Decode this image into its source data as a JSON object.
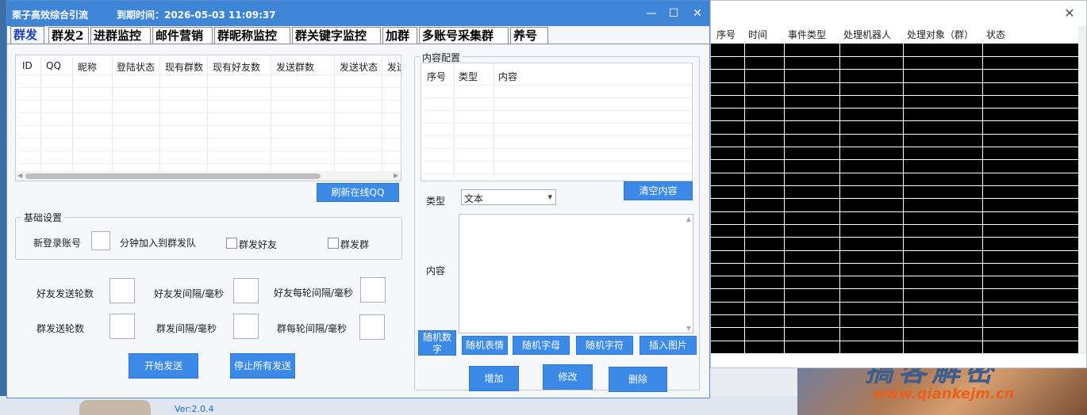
{
  "main_window": {
    "title": "栗子高效综合引流",
    "expiry": "到期时间：2026-05-03 11:09:37",
    "tabs": [
      "群发",
      "群发2",
      "进群监控",
      "邮件营销",
      "群昵称监控",
      "群关键字监控",
      "加群",
      "多账号采集群",
      "养号"
    ],
    "active_tab": "群发"
  },
  "accounts": {
    "columns": [
      "ID",
      "QQ",
      "昵称",
      "登陆状态",
      "现有群数",
      "现有好友数",
      "发送群数",
      "发送状态",
      "发送"
    ],
    "rows": [],
    "refresh_button": "刷新在线QQ"
  },
  "basic_settings": {
    "title": "基础设置",
    "new_login_label": "新登录账号",
    "new_login_value": "",
    "queue_label": "分钟加入到群发队",
    "friends_checkbox": "群发好友",
    "groups_checkbox": "群发群",
    "friends_checked": false,
    "groups_checked": false
  },
  "send_params": {
    "friend_rounds_label": "好友发送轮数",
    "friend_interval_label": "好友发间隔/毫秒",
    "friend_round_interval_label": "好友每轮间隔/毫秒",
    "group_rounds_label": "群发送轮数",
    "group_interval_label": "群发间隔/毫秒",
    "group_round_interval_label": "群每轮间隔/毫秒"
  },
  "actions": {
    "start": "开始发送",
    "stop": "停止所有发送"
  },
  "content_config": {
    "title": "内容配置",
    "columns": [
      "序号",
      "类型",
      "内容"
    ],
    "rows": [],
    "clear_button": "清空内容",
    "type_label": "类型",
    "type_value": "文本",
    "content_label": "内容",
    "insert_buttons": [
      "随机数字",
      "随机表情",
      "随机字母",
      "随机字符",
      "插入图片"
    ],
    "add": "增加",
    "edit": "修改",
    "delete": "删除"
  },
  "log_window": {
    "columns": [
      "序号",
      "时间",
      "事件类型",
      "处理机器人",
      "处理对象（群）",
      "状态"
    ]
  },
  "footer": {
    "version": "Ver:2.0.4"
  },
  "watermark": {
    "text": "搞客解密",
    "url": "www.qiankejm.cn"
  },
  "colors": {
    "titlebar": "#3f85d6",
    "button": "#3c8ae8",
    "log_background": "#000000",
    "active_tab_text": "#1a3fc0"
  }
}
